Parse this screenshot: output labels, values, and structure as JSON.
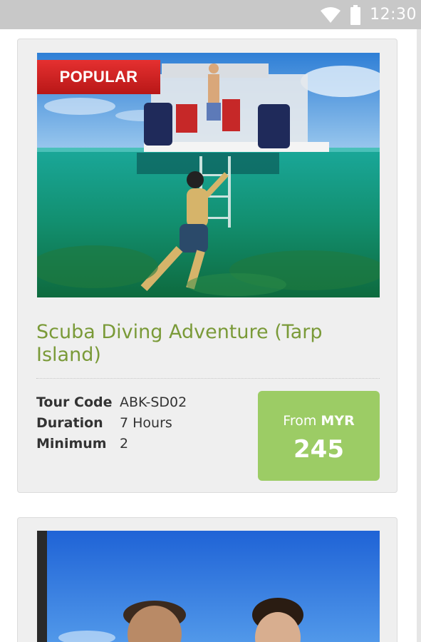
{
  "status_bar": {
    "time": "12:30",
    "icons": [
      "wifi-icon",
      "battery-icon"
    ]
  },
  "tours": [
    {
      "badge": "POPULAR",
      "title": "Scuba Diving Adventure (Tarp Island)",
      "details": [
        {
          "label": "Tour Code",
          "value": "ABK-SD02"
        },
        {
          "label": "Duration",
          "value": "7 Hours"
        },
        {
          "label": "Minimum",
          "value": "2"
        }
      ],
      "price": {
        "from_label": "From",
        "currency": "MYR",
        "amount": "245"
      }
    }
  ],
  "colors": {
    "title_green": "#7a9a38",
    "price_green": "#9ccc65",
    "badge_red": "#d42323",
    "status_bar": "#c8c8c8",
    "card_bg": "#efefef"
  }
}
